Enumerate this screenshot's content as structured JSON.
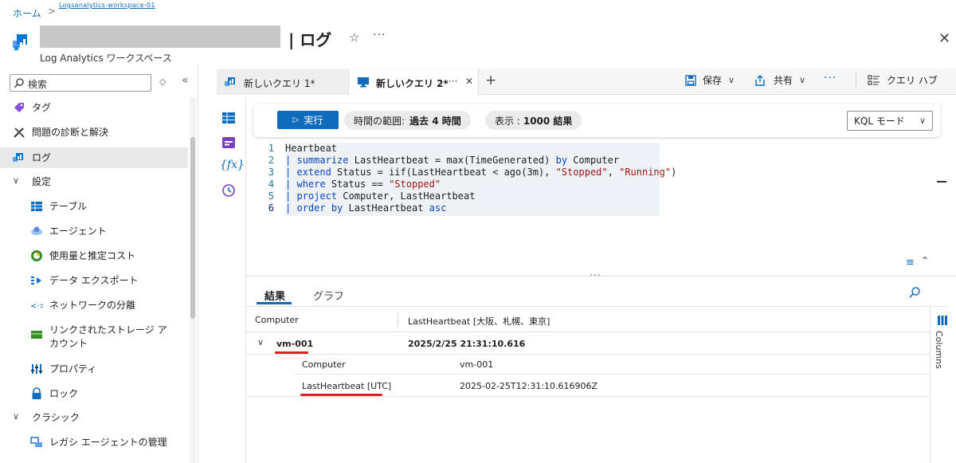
{
  "breadcrumb": {
    "home": "ホーム",
    "separator": ">",
    "workspace": "Logsanalytics-workspace-01"
  },
  "header": {
    "title": "| ログ",
    "subtitle": "Log Analytics ワークスペース",
    "star": "☆",
    "more": "···",
    "close": "✕"
  },
  "sidebar": {
    "search_placeholder": "検索",
    "items": [
      {
        "label": "タグ"
      },
      {
        "label": "問題の診断と解決"
      },
      {
        "label": "ログ"
      },
      {
        "label": "設定"
      },
      {
        "label": "テーブル"
      },
      {
        "label": "エージェント"
      },
      {
        "label": "使用量と推定コスト"
      },
      {
        "label": "データ エクスポート"
      },
      {
        "label": "ネットワークの分離"
      },
      {
        "label": "リンクされたストレージ アカウント",
        "line1": "リンクされたストレージ ア",
        "line2": "カウント"
      },
      {
        "label": "プロパティ"
      },
      {
        "label": "ロック"
      },
      {
        "label": "クラシック"
      },
      {
        "label": "レガシ エージェントの管理"
      }
    ]
  },
  "tabs": [
    {
      "label": "新しいクエリ 1*"
    },
    {
      "label": "新しいクエリ 2*",
      "more": "···",
      "close": "✕"
    }
  ],
  "toolbar": {
    "add": "+",
    "save": "保存",
    "share": "共有",
    "more": "···",
    "query_hub": "クエリ ハブ"
  },
  "query_bar": {
    "run": "実行",
    "time_range_label": "時間の範囲:",
    "time_range_value": "過去 4 時間",
    "display_label": "表示 :",
    "display_value": "1000 結果",
    "mode": "KQL モード"
  },
  "editor": {
    "line_numbers": [
      "1",
      "2",
      "3",
      "4",
      "5",
      "6"
    ],
    "lines": [
      "Heartbeat",
      "| summarize LastHeartbeat = max(TimeGenerated) by Computer",
      "| extend Status = iif(LastHeartbeat < ago(3m), \"Stopped\", \"Running\")",
      "| where Status == \"Stopped\"",
      "| project Computer, LastHeartbeat",
      "| order by LastHeartbeat asc"
    ]
  },
  "results": {
    "tabs": [
      "結果",
      "グラフ"
    ],
    "columns": [
      "Computer",
      "LastHeartbeat [大阪、札幌、東京]"
    ],
    "row": {
      "computer": "vm-001",
      "last_heartbeat": "2025/2/25 21:31:10.616"
    },
    "details": [
      {
        "key": "Computer",
        "value": "vm-001"
      },
      {
        "key": "LastHeartbeat [UTC]",
        "value": "2025-02-25T12:31:10.616906Z"
      }
    ],
    "columns_panel": "Columns"
  },
  "colors": {
    "accent": "#0f6cbd",
    "highlight_underline": "#e0201e"
  }
}
